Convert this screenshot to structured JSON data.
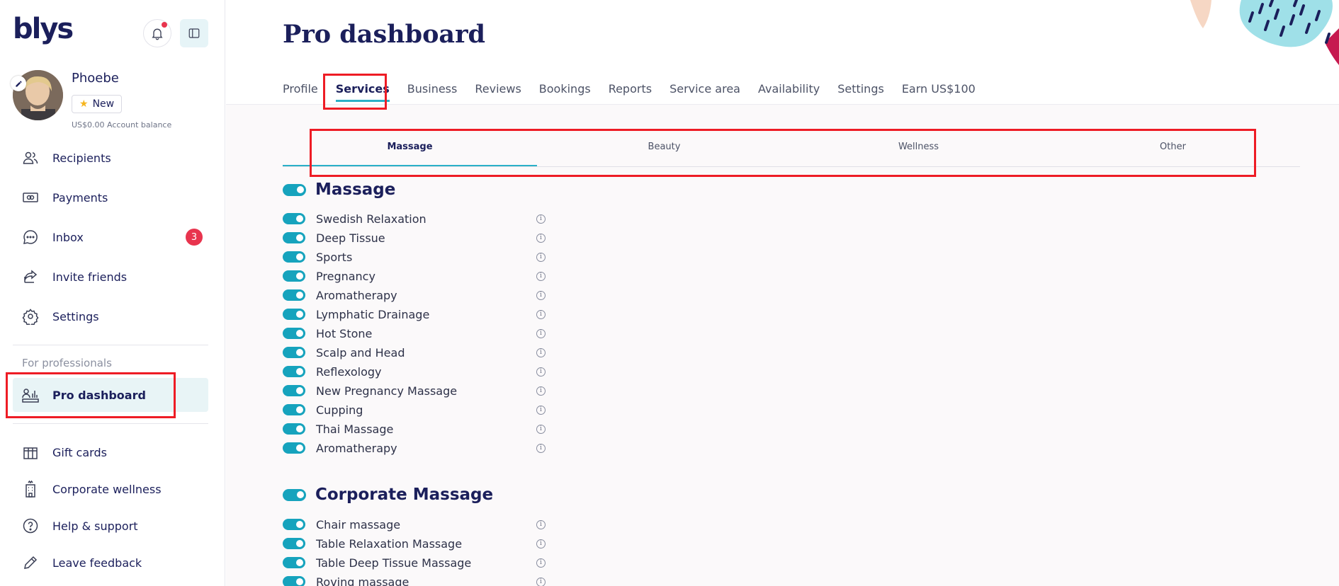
{
  "brand": {
    "logo_text": "blys"
  },
  "user": {
    "name": "Phoebe",
    "badge": "New",
    "balance": "US$0.00 Account balance"
  },
  "sidebar": {
    "items": [
      {
        "label": "Recipients",
        "icon": "users-icon"
      },
      {
        "label": "Payments",
        "icon": "money-icon"
      },
      {
        "label": "Inbox",
        "icon": "chat-icon",
        "count": "3"
      },
      {
        "label": "Invite friends",
        "icon": "share-icon"
      },
      {
        "label": "Settings",
        "icon": "gear-icon"
      }
    ],
    "section_label": "For professionals",
    "pro_item": "Pro dashboard",
    "bottom_items": [
      {
        "label": "Gift cards",
        "icon": "gift-icon"
      },
      {
        "label": "Corporate wellness",
        "icon": "building-icon"
      },
      {
        "label": "Help & support",
        "icon": "help-icon"
      },
      {
        "label": "Leave feedback",
        "icon": "pencil-icon"
      }
    ]
  },
  "header": {
    "title": "Pro dashboard",
    "tabs": [
      "Profile",
      "Services",
      "Business",
      "Reviews",
      "Bookings",
      "Reports",
      "Service area",
      "Availability",
      "Settings",
      "Earn US$100"
    ],
    "active_tab": "Services"
  },
  "subtabs": [
    "Massage",
    "Beauty",
    "Wellness",
    "Other"
  ],
  "sections": [
    {
      "title": "Massage",
      "services": [
        "Swedish Relaxation",
        "Deep Tissue",
        "Sports",
        "Pregnancy",
        "Aromatherapy",
        "Lymphatic Drainage",
        "Hot Stone",
        "Scalp and Head",
        "Reflexology",
        "New Pregnancy Massage",
        "Cupping",
        "Thai Massage",
        "Aromatherapy"
      ]
    },
    {
      "title": "Corporate Massage",
      "services": [
        "Chair massage",
        "Table Relaxation Massage",
        "Table Deep Tissue Massage",
        "Roving massage"
      ]
    }
  ],
  "colors": {
    "accent": "#16a3bd",
    "brand": "#1b1f5b",
    "alert": "#e8344e",
    "highlight": "#ee1c25"
  }
}
